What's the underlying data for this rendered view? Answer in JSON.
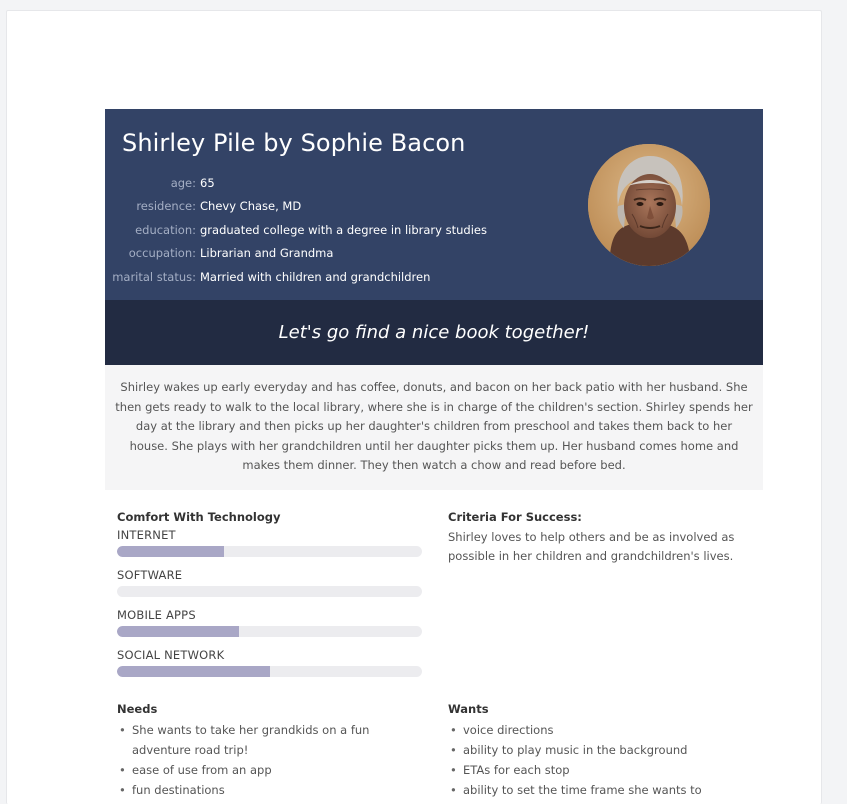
{
  "persona": {
    "title": "Shirley Pile by Sophie Bacon",
    "info": [
      {
        "label": "age:",
        "value": "65"
      },
      {
        "label": "residence:",
        "value": "Chevy Chase, MD"
      },
      {
        "label": "education:",
        "value": "graduated college with a degree in library studies"
      },
      {
        "label": "occupation:",
        "value": "Librarian and Grandma"
      },
      {
        "label": "marital status:",
        "value": "Married with children and grandchildren"
      }
    ],
    "avatar_icon": "elderly-woman-portrait",
    "quote": "Let's go find a nice book together!",
    "bio": "Shirley wakes up early everyday and has coffee, donuts, and bacon on her back patio with her husband. She then gets ready to walk to the local library, where she is in charge of the children's section. Shirley spends her day at the library and then picks up her daughter's children from preschool and takes them back to her house. She plays with her grandchildren until her daughter picks them up. Her husband comes home and makes them dinner. They then watch a chow and read before bed."
  },
  "technology": {
    "heading": "Comfort With Technology",
    "items": [
      {
        "label": "INTERNET",
        "level": 0.35
      },
      {
        "label": "SOFTWARE",
        "level": 0.0
      },
      {
        "label": "MOBILE APPS",
        "level": 0.4
      },
      {
        "label": "SOCIAL NETWORK",
        "level": 0.5
      }
    ]
  },
  "criteria": {
    "heading": "Criteria For Success:",
    "text": "Shirley loves to help others and be as involved as possible in her children and grandchildren's lives."
  },
  "needs": {
    "heading": "Needs",
    "items": [
      "She wants to take her grandkids on a fun adventure road trip!",
      "ease of use from an app",
      "fun destinations"
    ]
  },
  "wants": {
    "heading": "Wants",
    "items": [
      "voice directions",
      "ability to play music in the background",
      "ETAs for each stop",
      "ability to set the time frame she wants to"
    ]
  },
  "colors": {
    "header_bg": "#334366",
    "quote_bg": "#222b42",
    "bar_fill": "#a9a7c6",
    "bar_track": "#ececef"
  }
}
